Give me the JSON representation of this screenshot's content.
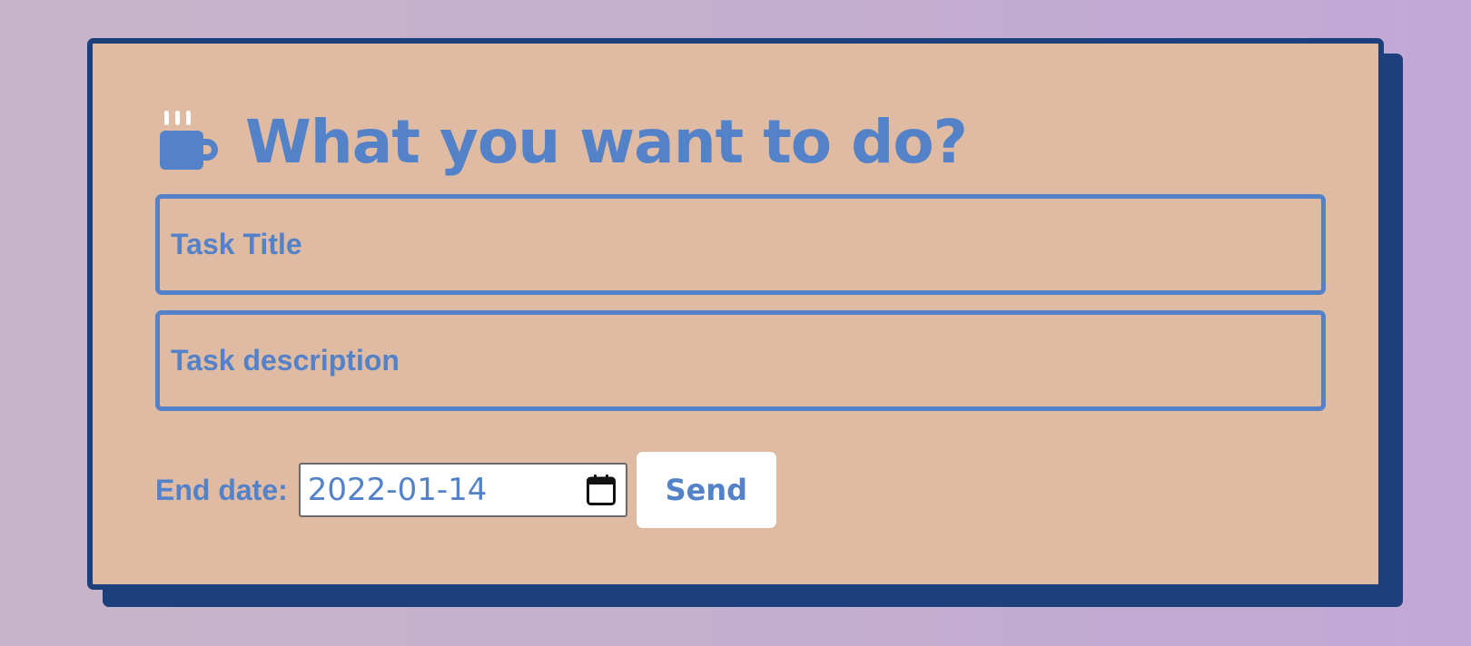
{
  "header": {
    "title": "What you want to do?",
    "icon": "coffee-mug-icon"
  },
  "form": {
    "task_title": {
      "placeholder": "Task Title",
      "value": ""
    },
    "task_description": {
      "placeholder": "Task description",
      "value": ""
    },
    "end_date": {
      "label": "End date:",
      "value": "2022-01-14",
      "icon": "calendar-icon"
    },
    "send_label": "Send"
  },
  "colors": {
    "background_start": "#c6b5c9",
    "background_end": "#c2a8d6",
    "card_background": "#dfbba3",
    "card_border": "#1d407c",
    "accent": "#5482c8",
    "button_background": "#ffffff"
  }
}
